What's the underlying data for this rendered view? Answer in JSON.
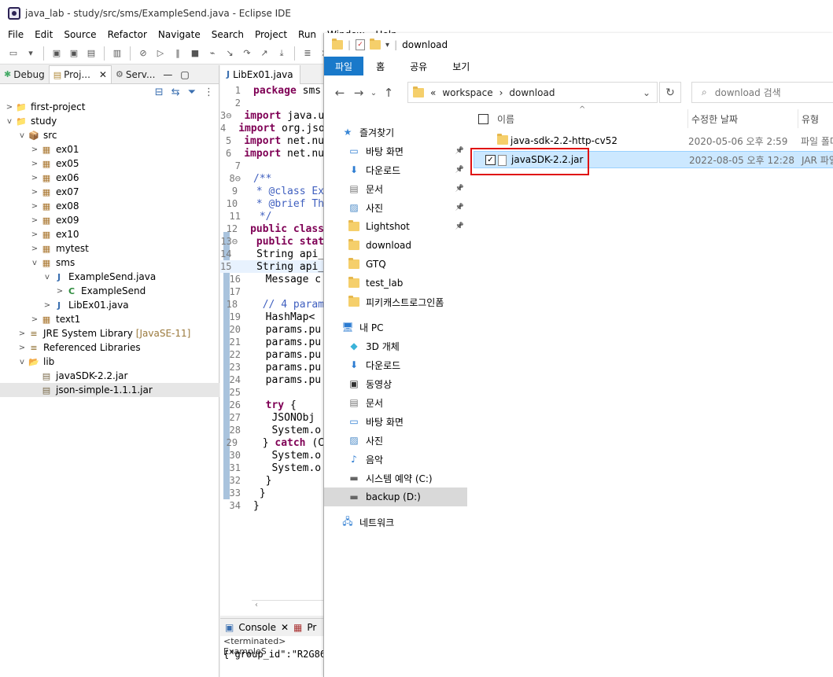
{
  "eclipse": {
    "title": "java_lab - study/src/sms/ExampleSend.java - Eclipse IDE",
    "menu": [
      "File",
      "Edit",
      "Source",
      "Refactor",
      "Navigate",
      "Search",
      "Project",
      "Run",
      "Window",
      "Help"
    ],
    "left_tabs": [
      {
        "label": "Debug"
      },
      {
        "label": "Proj...",
        "close": "✕"
      },
      {
        "label": "Serv..."
      }
    ],
    "tree": [
      {
        "label": "first-project",
        "depth": 0,
        "twisty": ">",
        "icon": "project-folder-icon",
        "glyph": "📁"
      },
      {
        "label": "study",
        "depth": 0,
        "twisty": "v",
        "icon": "project-folder-icon",
        "glyph": "📁"
      },
      {
        "label": "src",
        "depth": 1,
        "twisty": "v",
        "icon": "source-folder-icon",
        "glyph": "📦"
      },
      {
        "label": "ex01",
        "depth": 2,
        "twisty": ">",
        "icon": "package-icon",
        "glyph": "▦"
      },
      {
        "label": "ex05",
        "depth": 2,
        "twisty": ">",
        "icon": "package-icon",
        "glyph": "▦"
      },
      {
        "label": "ex06",
        "depth": 2,
        "twisty": ">",
        "icon": "package-icon",
        "glyph": "▦"
      },
      {
        "label": "ex07",
        "depth": 2,
        "twisty": ">",
        "icon": "package-icon",
        "glyph": "▦"
      },
      {
        "label": "ex08",
        "depth": 2,
        "twisty": ">",
        "icon": "package-icon",
        "glyph": "▦"
      },
      {
        "label": "ex09",
        "depth": 2,
        "twisty": ">",
        "icon": "package-icon",
        "glyph": "▦"
      },
      {
        "label": "ex10",
        "depth": 2,
        "twisty": ">",
        "icon": "package-icon",
        "glyph": "▦"
      },
      {
        "label": "mytest",
        "depth": 2,
        "twisty": ">",
        "icon": "package-icon",
        "glyph": "▦"
      },
      {
        "label": "sms",
        "depth": 2,
        "twisty": "v",
        "icon": "package-icon",
        "glyph": "▦"
      },
      {
        "label": "ExampleSend.java",
        "depth": 3,
        "twisty": "v",
        "icon": "java-file-icon",
        "glyph": "J"
      },
      {
        "label": "ExampleSend",
        "depth": 4,
        "twisty": ">",
        "icon": "class-icon",
        "glyph": "C"
      },
      {
        "label": "LibEx01.java",
        "depth": 3,
        "twisty": ">",
        "icon": "java-file-icon",
        "glyph": "J"
      },
      {
        "label": "text1",
        "depth": 2,
        "twisty": ">",
        "icon": "package-icon",
        "glyph": "▦"
      },
      {
        "label": "JRE System Library",
        "deco": "[JavaSE-11]",
        "depth": 1,
        "twisty": ">",
        "icon": "library-icon",
        "glyph": "≡"
      },
      {
        "label": "Referenced Libraries",
        "depth": 1,
        "twisty": ">",
        "icon": "library-icon",
        "glyph": "≡"
      },
      {
        "label": "lib",
        "depth": 1,
        "twisty": "v",
        "icon": "folder-icon",
        "glyph": "📂"
      },
      {
        "label": "javaSDK-2.2.jar",
        "depth": 2,
        "twisty": "",
        "icon": "jar-icon",
        "glyph": "▤"
      },
      {
        "label": "json-simple-1.1.1.jar",
        "depth": 2,
        "twisty": "",
        "icon": "jar-icon",
        "glyph": "▤",
        "selected": true
      }
    ],
    "editor_tab": "LibEx01.java",
    "code_lines": [
      {
        "n": "1",
        "t": [
          {
            "k": "kw",
            "s": "package"
          },
          {
            "k": "",
            "s": " sms"
          }
        ]
      },
      {
        "n": "2",
        "t": []
      },
      {
        "n": "3⊖",
        "t": [
          {
            "k": "kw",
            "s": "import"
          },
          {
            "k": "",
            "s": " java.u"
          }
        ]
      },
      {
        "n": "4",
        "t": [
          {
            "k": "kw",
            "s": "import"
          },
          {
            "k": "",
            "s": " org.jso"
          }
        ]
      },
      {
        "n": "5",
        "t": [
          {
            "k": "kw",
            "s": "import"
          },
          {
            "k": "",
            "s": " net.nu"
          }
        ]
      },
      {
        "n": "6",
        "t": [
          {
            "k": "kw",
            "s": "import"
          },
          {
            "k": "",
            "s": " net.nu"
          }
        ]
      },
      {
        "n": "7",
        "t": []
      },
      {
        "n": "8⊖",
        "t": [
          {
            "k": "cm",
            "s": "/**"
          }
        ]
      },
      {
        "n": "9",
        "t": [
          {
            "k": "cm",
            "s": " * @class Ex"
          }
        ]
      },
      {
        "n": "10",
        "t": [
          {
            "k": "cm",
            "s": " * @brief Th"
          }
        ]
      },
      {
        "n": "11",
        "t": [
          {
            "k": "cm",
            "s": " */"
          }
        ]
      },
      {
        "n": "12",
        "t": [
          {
            "k": "kw",
            "s": "public class"
          }
        ]
      },
      {
        "n": "13⊖",
        "t": [
          {
            "k": "kw",
            "s": " public stat"
          }
        ]
      },
      {
        "n": "14",
        "t": [
          {
            "k": "",
            "s": "  String api_"
          }
        ]
      },
      {
        "n": "15",
        "t": [
          {
            "k": "",
            "s": "  String api_"
          }
        ],
        "hl": true
      },
      {
        "n": "16",
        "t": [
          {
            "k": "",
            "s": "  Message c"
          }
        ]
      },
      {
        "n": "17",
        "t": []
      },
      {
        "n": "18",
        "t": [
          {
            "k": "cm",
            "s": "  // 4 param"
          }
        ]
      },
      {
        "n": "19",
        "t": [
          {
            "k": "",
            "s": "  HashMap<"
          }
        ]
      },
      {
        "n": "20",
        "t": [
          {
            "k": "",
            "s": "  params.pu"
          }
        ]
      },
      {
        "n": "21",
        "t": [
          {
            "k": "",
            "s": "  params.pu"
          }
        ]
      },
      {
        "n": "22",
        "t": [
          {
            "k": "",
            "s": "  params.pu"
          }
        ]
      },
      {
        "n": "23",
        "t": [
          {
            "k": "",
            "s": "  params.pu"
          }
        ]
      },
      {
        "n": "24",
        "t": [
          {
            "k": "",
            "s": "  params.pu"
          }
        ]
      },
      {
        "n": "25",
        "t": []
      },
      {
        "n": "26",
        "t": [
          {
            "k": "kw",
            "s": "  try"
          },
          {
            "k": "",
            "s": " {"
          }
        ]
      },
      {
        "n": "27",
        "t": [
          {
            "k": "",
            "s": "   JSONObj"
          }
        ]
      },
      {
        "n": "28",
        "t": [
          {
            "k": "",
            "s": "   System.o"
          }
        ]
      },
      {
        "n": "29",
        "t": [
          {
            "k": "",
            "s": "  } "
          },
          {
            "k": "kw",
            "s": "catch"
          },
          {
            "k": "",
            "s": " (C"
          }
        ]
      },
      {
        "n": "30",
        "t": [
          {
            "k": "",
            "s": "   System.o"
          }
        ]
      },
      {
        "n": "31",
        "t": [
          {
            "k": "",
            "s": "   System.o"
          }
        ]
      },
      {
        "n": "32",
        "t": [
          {
            "k": "",
            "s": "  }"
          }
        ]
      },
      {
        "n": "33",
        "t": [
          {
            "k": "",
            "s": " }"
          }
        ]
      },
      {
        "n": "34",
        "t": [
          {
            "k": "",
            "s": "}"
          }
        ]
      }
    ],
    "console_tab": "Console",
    "console_tab2": "Pr",
    "console_terminated": "<terminated> ExampleS",
    "console_output": "{\"group_id\":\"R2G86"
  },
  "explorer": {
    "title": "download",
    "ribbon_tabs": [
      "파일",
      "홈",
      "공유",
      "보기"
    ],
    "address": {
      "prefix": "«",
      "parts": [
        "workspace",
        "download"
      ],
      "sep": "›"
    },
    "search_placeholder": "download 검색",
    "nav": [
      {
        "label": "즐겨찾기",
        "icon": "star-icon",
        "glyph": "★",
        "color": "#3a87d6",
        "top": true
      },
      {
        "label": "바탕 화면",
        "icon": "desktop-icon",
        "glyph": "▭",
        "color": "#2b7bd1",
        "pin": true
      },
      {
        "label": "다운로드",
        "icon": "download-arrow-icon",
        "glyph": "⬇",
        "color": "#2b7bd1",
        "pin": true
      },
      {
        "label": "문서",
        "icon": "documents-icon",
        "glyph": "▤",
        "color": "#777",
        "pin": true
      },
      {
        "label": "사진",
        "icon": "pictures-icon",
        "glyph": "▨",
        "color": "#4a8ac7",
        "pin": true
      },
      {
        "label": "Lightshot",
        "icon": "folder-icon",
        "glyph": "",
        "pin": true
      },
      {
        "label": "download",
        "icon": "folder-icon",
        "glyph": ""
      },
      {
        "label": "GTQ",
        "icon": "folder-icon",
        "glyph": ""
      },
      {
        "label": "test_lab",
        "icon": "folder-icon",
        "glyph": ""
      },
      {
        "label": "피키캐스트로그인폼",
        "icon": "folder-icon",
        "glyph": ""
      },
      {
        "label": "",
        "spacer": true
      },
      {
        "label": "내 PC",
        "icon": "pc-icon",
        "glyph": "🖥",
        "color": "#2b7bd1",
        "top": true
      },
      {
        "label": "3D 개체",
        "icon": "3d-objects-icon",
        "glyph": "◆",
        "color": "#3bb3d9"
      },
      {
        "label": "다운로드",
        "icon": "download-arrow-icon",
        "glyph": "⬇",
        "color": "#2b7bd1"
      },
      {
        "label": "동영상",
        "icon": "video-icon",
        "glyph": "▣",
        "color": "#333"
      },
      {
        "label": "문서",
        "icon": "documents-icon",
        "glyph": "▤",
        "color": "#777"
      },
      {
        "label": "바탕 화면",
        "icon": "desktop-icon",
        "glyph": "▭",
        "color": "#2b7bd1"
      },
      {
        "label": "사진",
        "icon": "pictures-icon",
        "glyph": "▨",
        "color": "#4a8ac7"
      },
      {
        "label": "음악",
        "icon": "music-icon",
        "glyph": "♪",
        "color": "#2b7bd1"
      },
      {
        "label": "시스템 예약 (C:)",
        "icon": "drive-icon",
        "glyph": "▬",
        "color": "#666"
      },
      {
        "label": "backup (D:)",
        "icon": "drive-icon",
        "glyph": "▬",
        "color": "#666",
        "selected": true
      },
      {
        "label": "",
        "spacer": true
      },
      {
        "label": "네트워크",
        "icon": "network-icon",
        "glyph": "🖧",
        "color": "#2b7bd1",
        "top": true
      }
    ],
    "columns": {
      "name": "이름",
      "date": "수정한 날짜",
      "type": "유형"
    },
    "files": [
      {
        "name": "java-sdk-2.2-http-cv52",
        "date": "2020-05-06 오후 2:59",
        "type": "파일 폴더",
        "kind": "folder",
        "checked": false
      },
      {
        "name": "javaSDK-2.2.jar",
        "date": "2022-08-05 오후 12:28",
        "type": "JAR 파일",
        "kind": "file",
        "checked": true,
        "selected": true
      }
    ]
  },
  "colors": {
    "ribbon_file": "#1979ca",
    "selection": "#cce8ff",
    "highlight_box": "#e01010"
  }
}
